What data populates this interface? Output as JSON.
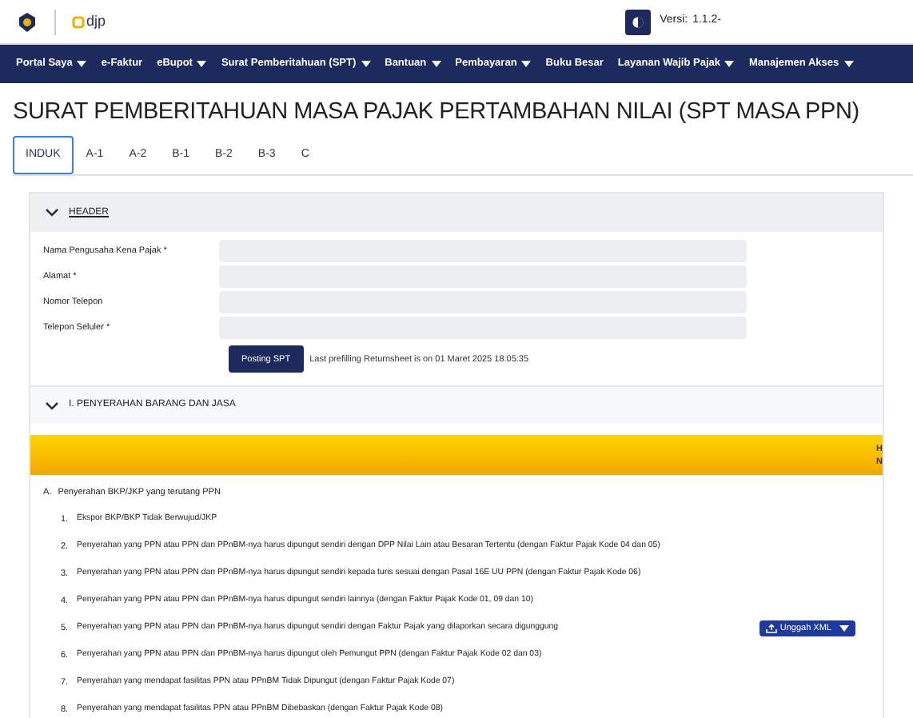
{
  "topbar": {
    "brand": "djp",
    "version_label": "Versi:",
    "version": "1.1.2-"
  },
  "nav": [
    {
      "label": "Portal Saya",
      "dropdown": true
    },
    {
      "label": "e-Faktur",
      "dropdown": false
    },
    {
      "label": "eBupot",
      "dropdown": true
    },
    {
      "label": "Surat Pemberitahuan (SPT)",
      "dropdown": true
    },
    {
      "label": "Bantuan",
      "dropdown": true
    },
    {
      "label": "Pembayaran",
      "dropdown": true
    },
    {
      "label": "Buku Besar",
      "dropdown": false
    },
    {
      "label": "Layanan Wajib Pajak",
      "dropdown": true
    },
    {
      "label": "Manajemen Akses",
      "dropdown": true
    }
  ],
  "page_title": "SURAT PEMBERITAHUAN MASA PAJAK PERTAMBAHAN NILAI (SPT MASA PPN)",
  "tabs": [
    {
      "label": "INDUK",
      "selected": true
    },
    {
      "label": "A-1",
      "selected": false
    },
    {
      "label": "A-2",
      "selected": false
    },
    {
      "label": "B-1",
      "selected": false
    },
    {
      "label": "B-2",
      "selected": false
    },
    {
      "label": "B-3",
      "selected": false
    },
    {
      "label": "C",
      "selected": false
    }
  ],
  "header_section": {
    "title": "HEADER",
    "expanded": true,
    "fields": [
      {
        "label": "Nama Pengusaha Kena Pajak *"
      },
      {
        "label": "Alamat *"
      },
      {
        "label": "Nomor Telepon"
      },
      {
        "label": "Telepon Seluler *"
      }
    ],
    "button": "Posting SPT",
    "note": "Last prefilling Returnsheet is on 01 Maret 2025 18:05:35"
  },
  "section_1": {
    "title": "I. PENYERAHAN BARANG DAN JASA",
    "expanded": true,
    "banner_lines": [
      "H",
      "N"
    ],
    "group_title": "A.",
    "group_label": "Penyerahan BKP/JKP yang terutang PPN",
    "items": [
      {
        "number": "1.",
        "text": "Ekspor BKP/BKP Tidak Berwujud/JKP"
      },
      {
        "number": "2.",
        "text": "Penyerahan yang PPN atau PPN dan PPnBM-nya harus dipungut sendiri dengan DPP Nilai Lain atau Besaran Tertentu (dengan Faktur Pajak Kode 04 dan 05)"
      },
      {
        "number": "3.",
        "text": "Penyerahan yang PPN atau PPN dan PPnBM-nya harus dipungut sendiri kepada turis sesuai dengan Pasal 16E UU PPN (dengan Faktur Pajak Kode 06)"
      },
      {
        "number": "4.",
        "text": "Penyerahan yang PPN atau PPN dan PPnBM-nya harus dipungut sendiri lainnya (dengan Faktur Pajak Kode 01, 09 dan 10)"
      },
      {
        "number": "5.",
        "text": "Penyerahan yang PPN atau PPN dan PPnBM-nya harus dipungut sendiri dengan Faktur Pajak yang dilaporkan secara digunggung",
        "button": "Unggah XML"
      },
      {
        "number": "6.",
        "text": "Penyerahan yang PPN atau PPN dan PPnBM-nya harus dipungut oleh Pemungut PPN (dengan Faktur Pajak Kode 02 dan 03)"
      },
      {
        "number": "7.",
        "text": "Penyerahan yang mendapat fasilitas PPN atau PPnBM Tidak Dipungut (dengan Faktur Pajak Kode 07)"
      },
      {
        "number": "8.",
        "text": "Penyerahan yang mendapat fasilitas PPN atau PPnBM Dibebaskan (dengan Faktur Pajak Kode 08)"
      }
    ]
  }
}
